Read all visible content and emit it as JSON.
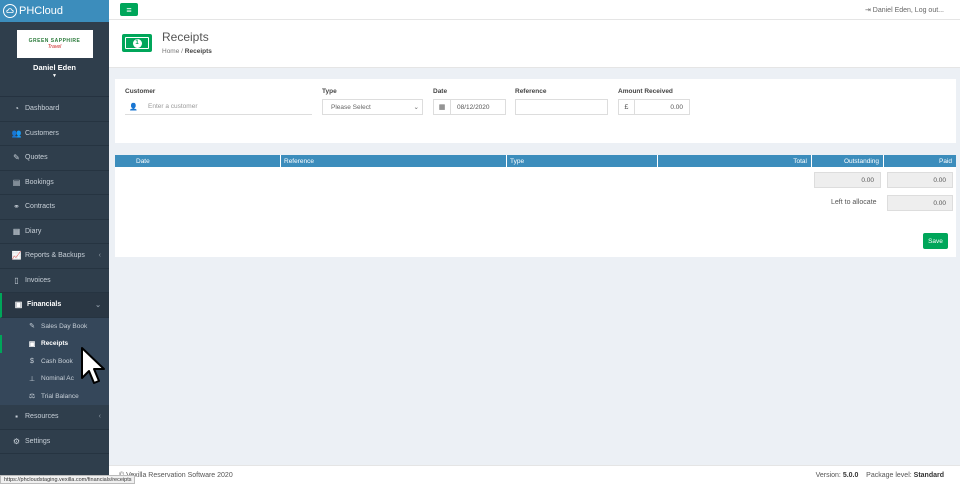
{
  "brand": {
    "name": "PHCloud"
  },
  "user_panel": {
    "logo_line1": "GREEN SAPPHIRE",
    "logo_line2": "Travel",
    "username": "Daniel Eden"
  },
  "sidebar": {
    "items": [
      {
        "label": "Dashboard",
        "icon": "dashboard-icon"
      },
      {
        "label": "Customers",
        "icon": "users-icon"
      },
      {
        "label": "Quotes",
        "icon": "pencil-icon"
      },
      {
        "label": "Bookings",
        "icon": "book-icon"
      },
      {
        "label": "Contracts",
        "icon": "handshake-icon"
      },
      {
        "label": "Diary",
        "icon": "calendar-icon"
      },
      {
        "label": "Reports & Backups",
        "icon": "chart-icon"
      },
      {
        "label": "Invoices",
        "icon": "invoice-icon"
      },
      {
        "label": "Financials",
        "icon": "money-icon"
      }
    ],
    "financials_sub": [
      {
        "label": "Sales Day Book",
        "icon": "edit-icon"
      },
      {
        "label": "Receipts",
        "icon": "money-icon"
      },
      {
        "label": "Cash Book",
        "icon": "dollar-icon"
      },
      {
        "label": "Nominal Ac",
        "icon": "sitemap-icon"
      },
      {
        "label": "Trial Balance",
        "icon": "balance-icon"
      }
    ],
    "items_after": [
      {
        "label": "Resources",
        "icon": "briefcase-icon"
      },
      {
        "label": "Settings",
        "icon": "cogs-icon"
      }
    ]
  },
  "topbar": {
    "user_link": "Daniel Eden, Log out..."
  },
  "page": {
    "title": "Receipts",
    "crumb_home": "Home",
    "crumb_current": "Receipts"
  },
  "form": {
    "customer_label": "Customer",
    "customer_placeholder": "Enter a customer",
    "type_label": "Type",
    "type_selected": "Please Select",
    "date_label": "Date",
    "date_value": "08/12/2020",
    "reference_label": "Reference",
    "reference_value": "",
    "amount_label": "Amount Received",
    "currency_symbol": "£",
    "amount_value": "0.00"
  },
  "table": {
    "headers": {
      "date": "Date",
      "reference": "Reference",
      "type": "Type",
      "total": "Total",
      "outstanding": "Outstanding",
      "paid": "Paid"
    },
    "outstanding_total": "0.00",
    "paid_total": "0.00",
    "left_to_allocate_label": "Left to allocate",
    "left_to_allocate_value": "0.00",
    "save_label": "Save"
  },
  "footer": {
    "copyright": "© Vexilla Reservation Software 2020",
    "version_label": "Version:",
    "version": "5.0.0",
    "package_label": "Package level:",
    "package": "Standard"
  },
  "status_url": "https://phcloudstaging.vexilla.com/financials/receipts",
  "colors": {
    "sidebar": "#2f3e4c",
    "accent_green": "#00a65a",
    "header_blue": "#3c8dbc"
  }
}
